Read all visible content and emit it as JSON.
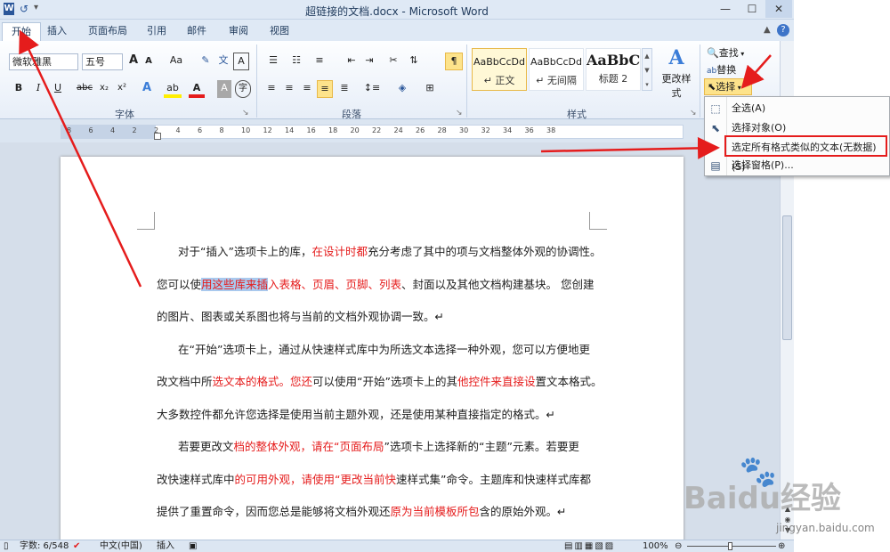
{
  "app": {
    "title": "超链接的文档.docx - Microsoft Word"
  },
  "titlebar": {
    "minimize": "—",
    "maximize": "☐",
    "close": "✕"
  },
  "tabs": [
    "开始",
    "插入",
    "页面布局",
    "引用",
    "邮件",
    "审阅",
    "视图"
  ],
  "ribbon": {
    "font_name": "微软雅黑",
    "font_size": "五号",
    "grow_font": "A",
    "shrink_font": "A",
    "change_case": "Aa",
    "bold": "B",
    "italic": "I",
    "underline": "U",
    "strike": "abc",
    "subscript": "x₂",
    "superscript": "x²",
    "group_font": "字体",
    "group_paragraph": "段落",
    "group_styles": "样式",
    "styles": [
      {
        "sample": "AaBbCcDd",
        "name": "↵ 正文"
      },
      {
        "sample": "AaBbCcDd",
        "name": "↵ 无间隔"
      },
      {
        "sample": "AaBbC",
        "name": "标题 2"
      }
    ],
    "change_styles": "更改样式",
    "find": "查找",
    "replace": "替换",
    "select": "选择"
  },
  "ruler": {
    "ticks": [
      "8",
      "6",
      "4",
      "2",
      "2",
      "4",
      "6",
      "8",
      "10",
      "12",
      "14",
      "16",
      "18",
      "20",
      "22",
      "24",
      "26",
      "28",
      "30",
      "32",
      "34",
      "36",
      "38"
    ]
  },
  "document": {
    "lines": [
      [
        {
          "t": "对于“插入”选项卡上的库，"
        },
        {
          "t": "在设计时都",
          "c": "red"
        },
        {
          "t": "充分考虑了其中的项与文档整体外观的协调性。"
        }
      ],
      [
        {
          "t": "您可以使"
        },
        {
          "t": "用这些库来插",
          "c": "sel"
        },
        {
          "t": "入表格、页眉、页脚、列表",
          "c": "red"
        },
        {
          "t": "、封面以及其他文档构建基块。 您创建"
        }
      ],
      [
        {
          "t": "的图片、图表或关系图也将与当前的文档外观协调一致。↵"
        }
      ],
      [
        {
          "t": "在“开始”选项卡上，通过从快速样式库中为所选文本选择一种外观，您可以方便地更"
        }
      ],
      [
        {
          "t": "改文档中所"
        },
        {
          "t": "选文本的格式。您还",
          "c": "red"
        },
        {
          "t": "可以使用“开始”选项卡上的其"
        },
        {
          "t": "他控件来直接设",
          "c": "red"
        },
        {
          "t": "置文本格式。"
        }
      ],
      [
        {
          "t": "大多数控件都允许您选择是使用当前主题外观，还是使用某种直接指定的格式。↵"
        }
      ],
      [
        {
          "t": "若要更改文"
        },
        {
          "t": "档的整体外观，请在“页面布局",
          "c": "red"
        },
        {
          "t": "”选项卡上选择新的“主题”元素。若要更"
        }
      ],
      [
        {
          "t": "改快速样式库中"
        },
        {
          "t": "的可用外观，请使用“更改当前快",
          "c": "red"
        },
        {
          "t": "速样式集”命令。主题库和快速样式库都"
        }
      ],
      [
        {
          "t": "提供了重置命令，因而您总是能够将文档外观还"
        },
        {
          "t": "原为当前模板所包",
          "c": "red"
        },
        {
          "t": "含的原始外观。↵"
        }
      ]
    ]
  },
  "menu": {
    "items": [
      {
        "label": "全选(A)",
        "icon": "select-all-icon"
      },
      {
        "label": "选择对象(O)",
        "icon": "cursor-icon"
      },
      {
        "label": "选定所有格式类似的文本(无数据)(S)",
        "icon": ""
      },
      {
        "label": "选择窗格(P)...",
        "icon": "selection-pane-icon"
      }
    ]
  },
  "status": {
    "words": "字数: 6/548",
    "language": "中文(中国)",
    "mode": "插入",
    "zoom": "100%"
  },
  "watermark": {
    "brand": "Baidu经验",
    "url": "jingyan.baidu.com"
  },
  "colors": {
    "accent": "#e51c1c",
    "ribbon_bg": "#dfe9f5",
    "selection": "#a9c9ee"
  }
}
